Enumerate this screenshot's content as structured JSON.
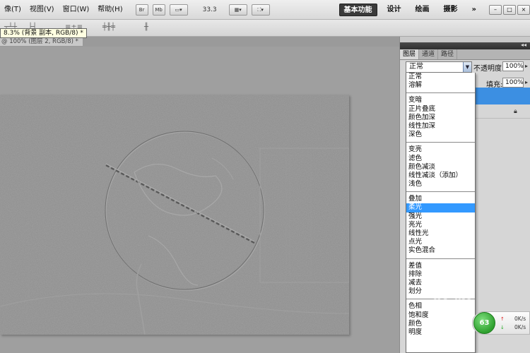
{
  "menu": {
    "items": [
      "像(T)",
      "视图(V)",
      "窗口(W)",
      "帮助(H)"
    ],
    "buttons": [
      "Br",
      "Mb"
    ],
    "zoom": "33.3",
    "workspaces": [
      "基本功能",
      "设计",
      "绘画",
      "摄影"
    ],
    "more": "»",
    "window_controls": [
      "–",
      "□",
      "×"
    ]
  },
  "tooltip": "8.3% (背景 副本, RGB/8) *",
  "doc_tab": "@ 100% (图层 2, RGB/8) *",
  "panel": {
    "tabs": [
      "图层",
      "通道",
      "路径"
    ],
    "blend_mode": "正常",
    "opacity_label": "不透明度:",
    "opacity_value": "100%",
    "fill_label": "填充:",
    "fill_value": "100%",
    "collapse": "◂◂"
  },
  "blend_modes": {
    "groups": [
      [
        "正常",
        "溶解"
      ],
      [
        "变暗",
        "正片叠底",
        "颜色加深",
        "线性加深",
        "深色"
      ],
      [
        "变亮",
        "滤色",
        "颜色减淡",
        "线性减淡（添加）",
        "浅色"
      ],
      [
        "叠加",
        "柔光",
        "强光",
        "亮光",
        "线性光",
        "点光",
        "实色混合"
      ],
      [
        "差值",
        "排除",
        "减去",
        "划分"
      ],
      [
        "色相",
        "饱和度",
        "颜色",
        "明度"
      ]
    ],
    "selected": "柔光"
  },
  "badge": {
    "label": "63",
    "up": "0K/s",
    "down": "0K/s"
  },
  "watermark": "经验"
}
